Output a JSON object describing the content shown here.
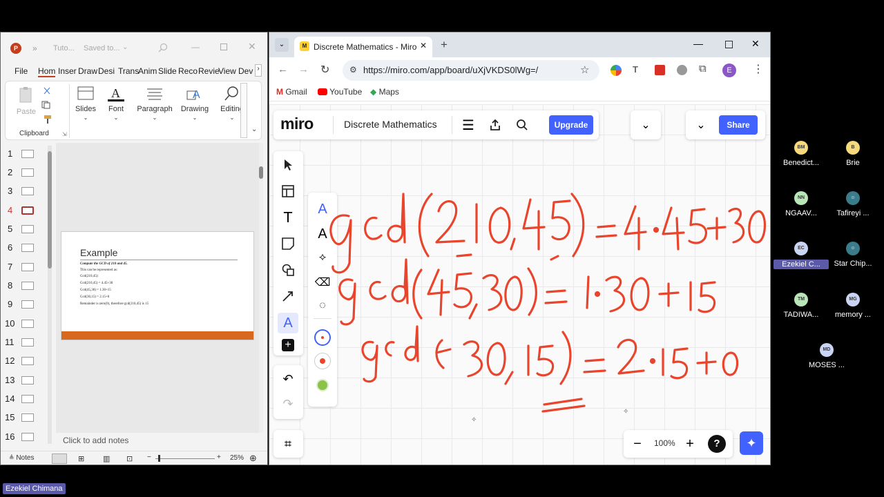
{
  "ppt": {
    "title": "Tuto...",
    "saved": "Saved to...",
    "tabs": [
      "File",
      "Hom",
      "Inser",
      "Draw",
      "Desi",
      "Trans",
      "Anim",
      "Slide",
      "Reco",
      "Revie",
      "View",
      "Dev"
    ],
    "ribbon": {
      "paste": "Paste",
      "clipboard": "Clipboard",
      "slides": "Slides",
      "font": "Font",
      "paragraph": "Paragraph",
      "drawing": "Drawing",
      "editing": "Editing"
    },
    "thumbnail_numbers": [
      "1",
      "2",
      "3",
      "4",
      "5",
      "6",
      "7",
      "8",
      "9",
      "10",
      "11",
      "12",
      "13",
      "14",
      "15",
      "16"
    ],
    "active_slide": 4,
    "slide": {
      "title": "Example",
      "lines": [
        "Compute the GCD of 210 and 45.",
        "This can be represented as:",
        "Gcd(210,45):",
        "Gcd(210,45)       =        4.45+30",
        "Gcd(45,30)         =        1.30+15",
        "Gcd(30,15)         =        2.15+0",
        "Remainder is zero(0), therefore gcd(210,45) is 15"
      ]
    },
    "notes_placeholder": "Click to add notes",
    "status": {
      "notes": "Notes",
      "zoom": "25%"
    }
  },
  "chrome": {
    "tab_title": "Discrete Mathematics - Miro",
    "url": "https://miro.com/app/board/uXjVKDS0lWg=/",
    "bookmarks": [
      "Gmail",
      "YouTube",
      "Maps"
    ],
    "profile_initial": "E"
  },
  "miro": {
    "logo": "miro",
    "board_name": "Discrete Mathematics",
    "upgrade": "Upgrade",
    "share": "Share",
    "zoom": "100%",
    "help": "?",
    "pen_color": "#e8452c"
  },
  "participants": [
    {
      "initials": "BM",
      "name": "Benedict...",
      "color": "#f5d97a"
    },
    {
      "initials": "B",
      "name": "Brie",
      "color": "#f5d97a"
    },
    {
      "initials": "NN",
      "name": "NGAAV...",
      "color": "#b8e6b8"
    },
    {
      "initials": "",
      "name": "Tafireyi ...",
      "color": "#3a7c8c"
    },
    {
      "initials": "EC",
      "name": "Ezekiel C...",
      "color": "#c9d4f5",
      "highlight": true
    },
    {
      "initials": "",
      "name": "Star Chip...",
      "color": "#3a7c8c"
    },
    {
      "initials": "TM",
      "name": "TADIWA...",
      "color": "#b8e6b8"
    },
    {
      "initials": "MG",
      "name": "memory ...",
      "color": "#c9d4f5"
    },
    {
      "initials": "MD",
      "name": "MOSES ...",
      "color": "#c9d4f5"
    }
  ],
  "caption": "Ezekiel Chimana"
}
